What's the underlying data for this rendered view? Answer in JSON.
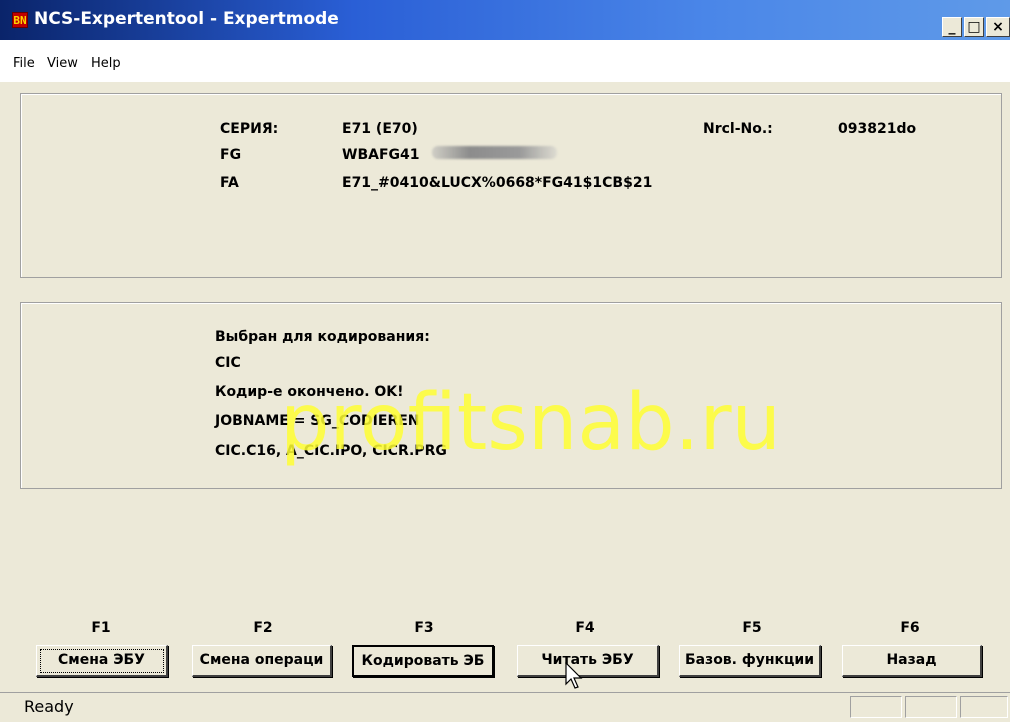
{
  "window": {
    "title": "NCS-Expertentool - Expertmode",
    "icon_text": "BN",
    "controls": {
      "minimize": "_",
      "maximize": "□",
      "close": "×"
    }
  },
  "menu": [
    "File",
    "View",
    "Help"
  ],
  "info_panel": {
    "series_label": "СЕРИЯ:",
    "series_value": "E71 (E70)",
    "fg_label": "FG",
    "fg_value": "WBAFG41",
    "fa_label": "FA",
    "fa_value": "E71_#0410&LUCX%0668*FG41$1CB$21",
    "nrcl_label": "Nrcl-No.:",
    "nrcl_value": "093821do"
  },
  "message_panel": {
    "lines": [
      "Выбран для кодирования:",
      "CIC",
      "Кодир-е окончено. OK!",
      "JOBNAME = SG_CODIEREN",
      "CIC.C16, A_CIC.IPO, CICR.PRG"
    ]
  },
  "watermark": "profitsnab.ru",
  "function_keys": [
    {
      "key": "F1",
      "label": "Смена ЭБУ"
    },
    {
      "key": "F2",
      "label": "Смена операци"
    },
    {
      "key": "F3",
      "label": "Кодировать ЭБ"
    },
    {
      "key": "F4",
      "label": "Читать ЭБУ"
    },
    {
      "key": "F5",
      "label": "Базов. функции"
    },
    {
      "key": "F6",
      "label": "Назад"
    }
  ],
  "status": {
    "text": "Ready"
  }
}
